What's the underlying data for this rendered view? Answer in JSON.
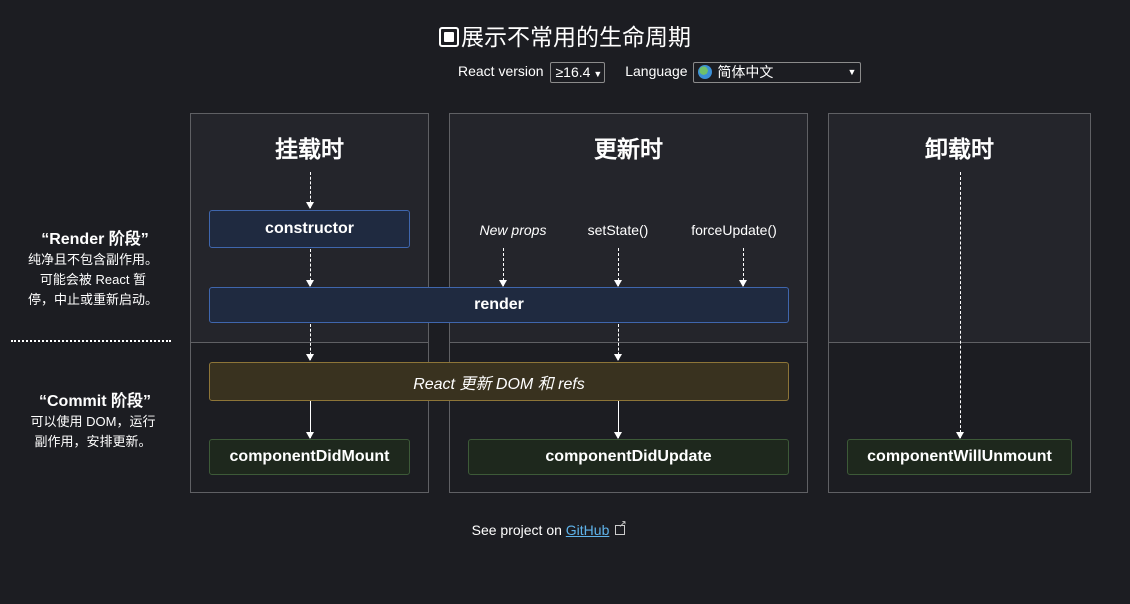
{
  "header": {
    "title": "展示不常用的生命周期",
    "react_version_label": "React version",
    "react_version_value": "≥16.4",
    "language_label": "Language",
    "language_value": "简体中文",
    "language_icon": "globe-icon"
  },
  "legend": {
    "render_title": "“Render 阶段”",
    "render_desc_1": "纯净且不包含副作用。",
    "render_desc_2": "可能会被 React 暂",
    "render_desc_3": "停，中止或重新启动。",
    "commit_title": "“Commit 阶段”",
    "commit_desc_1": "可以使用 DOM，运行",
    "commit_desc_2": "副作用，安排更新。"
  },
  "phases": {
    "mounting": "挂载时",
    "updating": "更新时",
    "unmounting": "卸载时"
  },
  "triggers": {
    "new_props": "New props",
    "set_state": "setState()",
    "force_update": "forceUpdate()"
  },
  "methods": {
    "constructor": "constructor",
    "render": "render",
    "react_updates": "React 更新 DOM 和 refs",
    "did_mount": "componentDidMount",
    "did_update": "componentDidUpdate",
    "will_unmount": "componentWillUnmount"
  },
  "footer": {
    "prefix": "See project on",
    "link": "GitHub"
  },
  "colors": {
    "background": "#1c1d22",
    "render_box": "#1f2a40",
    "commit_box": "#1e281d",
    "dom_box": "#39321f",
    "link": "#5fb3ea"
  }
}
